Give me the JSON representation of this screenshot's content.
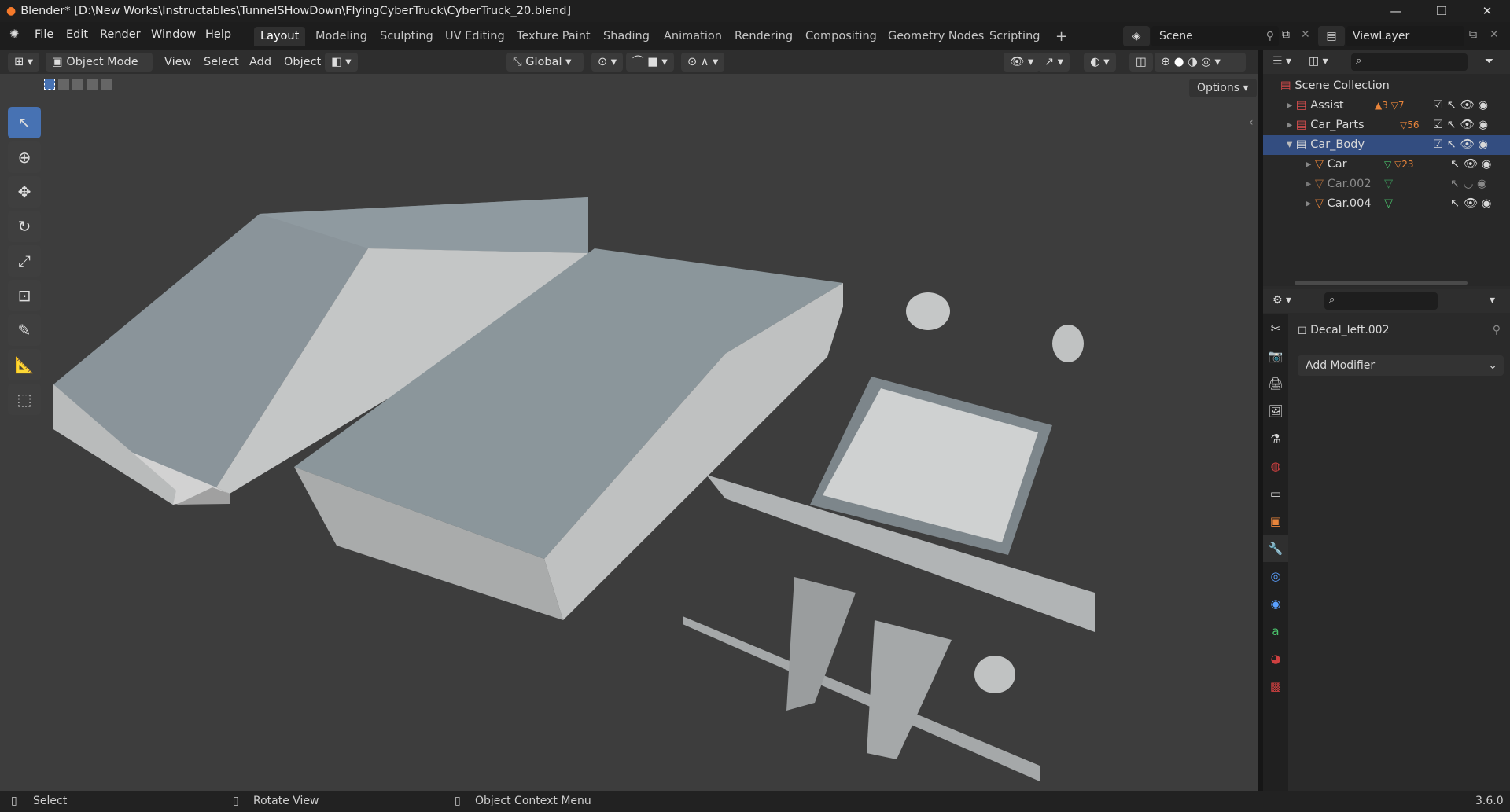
{
  "titlebar": {
    "title": "Blender* [D:\\New Works\\Instructables\\TunnelSHowDown\\FlyingCyberTruck\\CyberTruck_20.blend]"
  },
  "menu": {
    "items": [
      "File",
      "Edit",
      "Render",
      "Window",
      "Help"
    ]
  },
  "workspaces": [
    "Layout",
    "Modeling",
    "Sculpting",
    "UV Editing",
    "Texture Paint",
    "Shading",
    "Animation",
    "Rendering",
    "Compositing",
    "Geometry Nodes",
    "Scripting"
  ],
  "scene": {
    "name": "Scene",
    "view_layer": "ViewLayer"
  },
  "header": {
    "mode": "Object Mode",
    "view": "View",
    "select": "Select",
    "add": "Add",
    "object": "Object",
    "orientation": "Global",
    "options": "Options"
  },
  "outliner": {
    "root": "Scene Collection",
    "rows": [
      {
        "label": "Assist",
        "badge1": "3",
        "badge2": "7"
      },
      {
        "label": "Car_Parts",
        "badge1": "56"
      },
      {
        "label": "Car_Body"
      },
      {
        "label": "Car",
        "badge2": "23"
      },
      {
        "label": "Car.002"
      },
      {
        "label": "Car.004"
      }
    ]
  },
  "properties": {
    "object_name": "Decal_left.002",
    "add_modifier": "Add Modifier"
  },
  "status": {
    "left": "Select",
    "middle": "Rotate View",
    "right": "Object Context Menu",
    "version": "3.6.0"
  }
}
